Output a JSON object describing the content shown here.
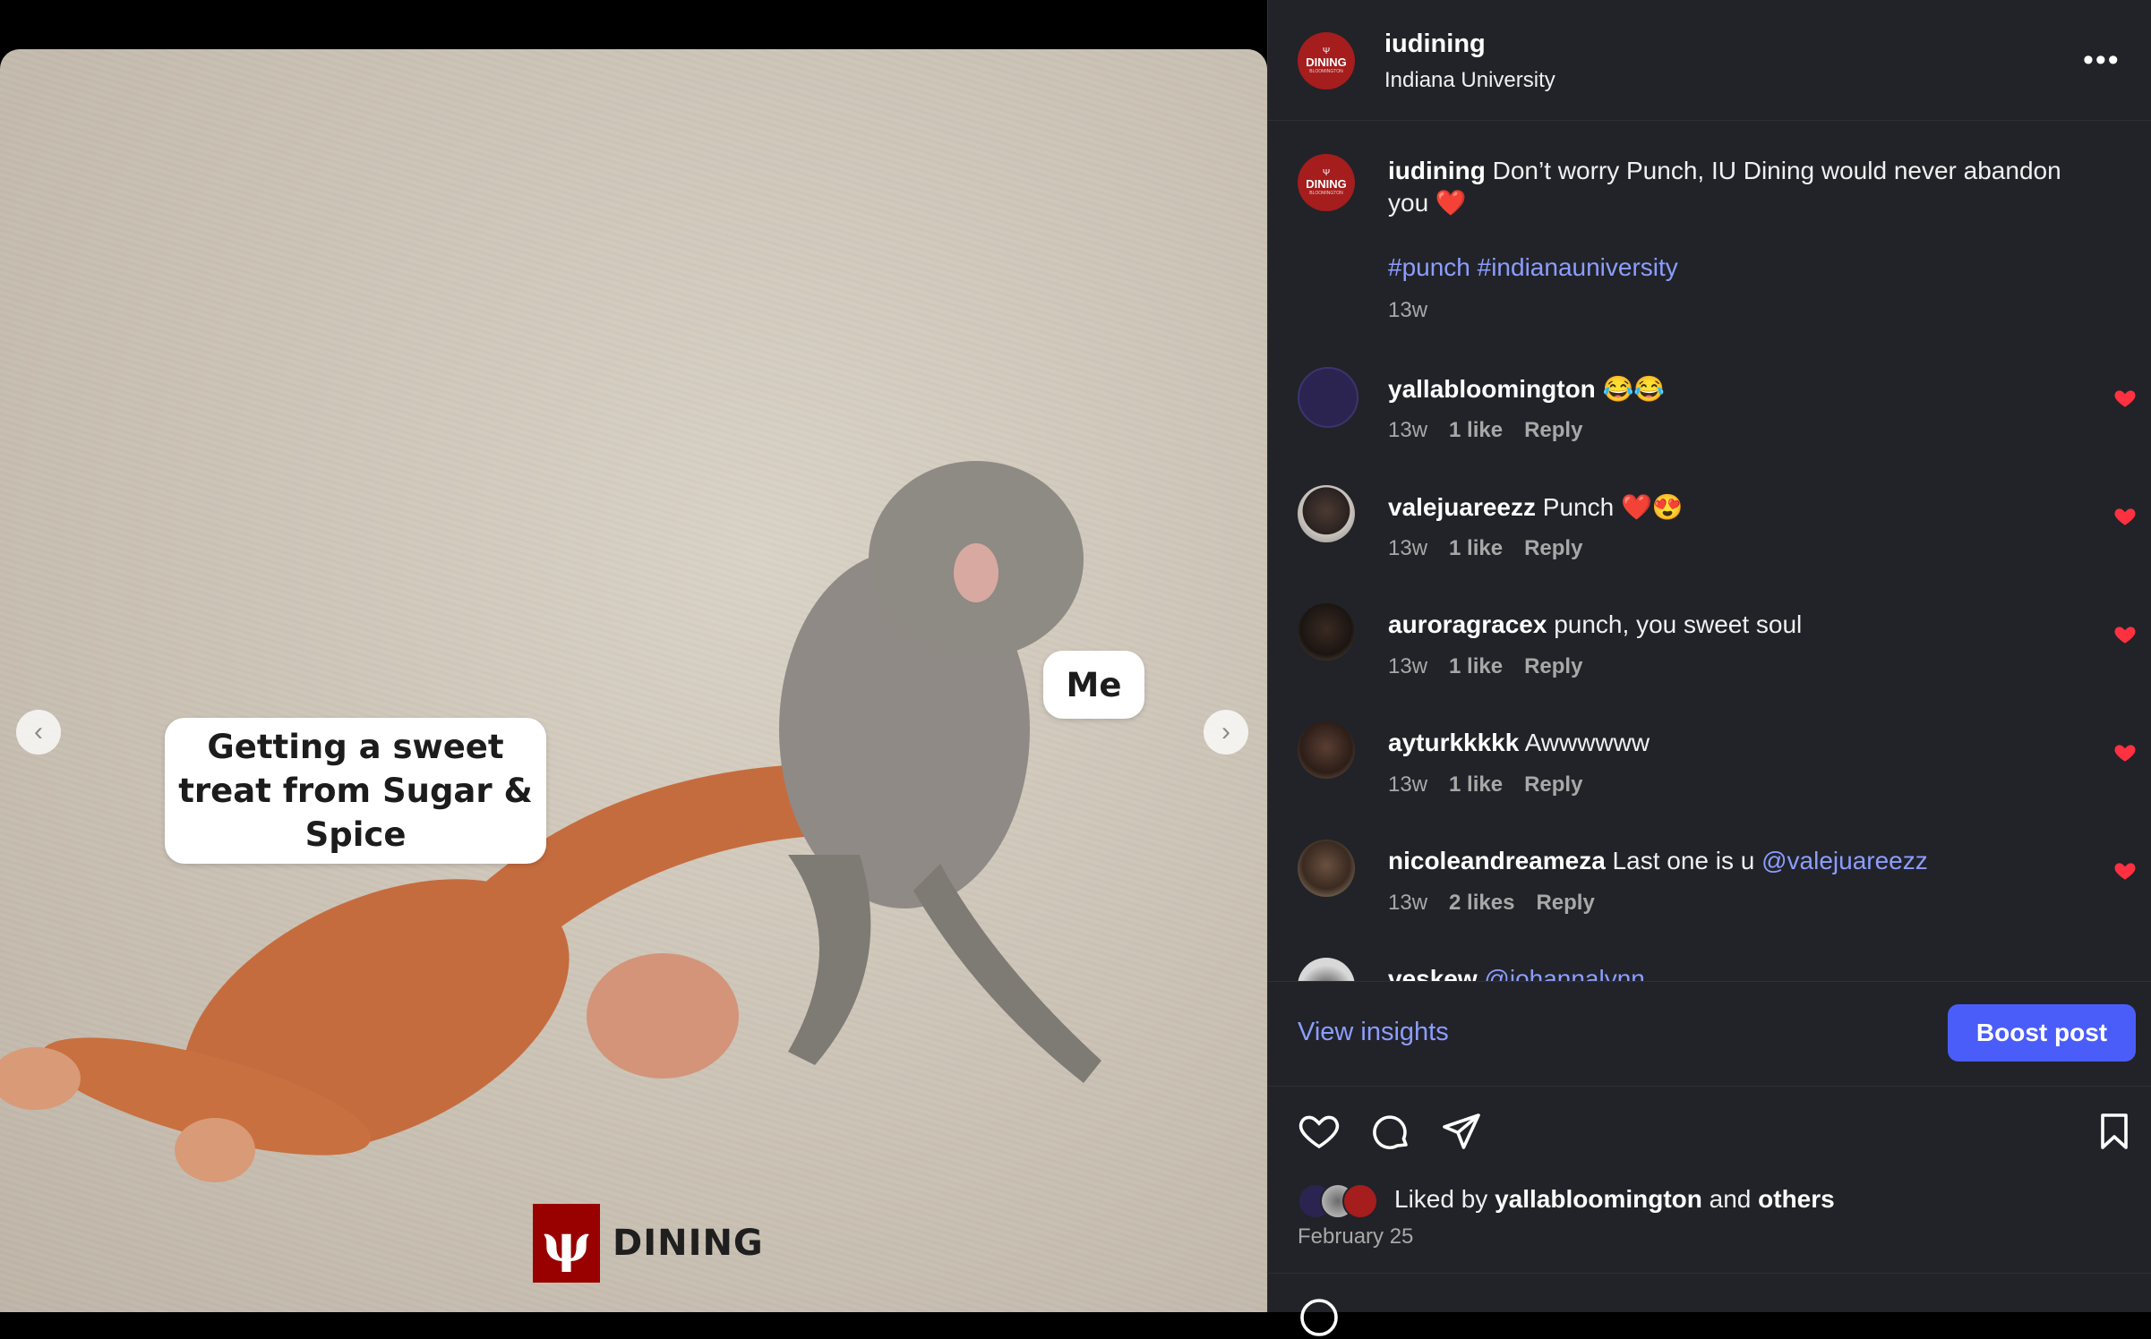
{
  "post": {
    "caption_left": "Getting a sweet treat from Sugar & Spice",
    "caption_right": "Me",
    "logo_text": "DINING",
    "logo_mark": "ψ",
    "prev_arrow": "‹",
    "next_arrow": "›"
  },
  "header": {
    "username": "iudining",
    "location": "Indiana University",
    "more": "•••",
    "avatar": {
      "line1": "Ψ",
      "line2": "DINING",
      "line3": "BLOOMINGTON"
    }
  },
  "caption": {
    "username": "iudining",
    "text": " Don’t worry Punch, IU Dining would never abandon you ❤️",
    "hashtags": "#punch #indianauniversity",
    "time": "13w"
  },
  "comments": [
    {
      "username": "yallabloomington",
      "text": " 😂😂",
      "time": "13w",
      "likes": "1 like",
      "reply": "Reply"
    },
    {
      "username": "valejuareezz",
      "text": " Punch ❤️😍",
      "time": "13w",
      "likes": "1 like",
      "reply": "Reply"
    },
    {
      "username": "auroragracex",
      "text": " punch, you sweet soul",
      "time": "13w",
      "likes": "1 like",
      "reply": "Reply"
    },
    {
      "username": "ayturkkkkk",
      "text": " Awwwwww",
      "time": "13w",
      "likes": "1 like",
      "reply": "Reply"
    },
    {
      "username": "nicoleandreameza",
      "text": " Last one is u ",
      "mention": "@valejuareezz",
      "time": "13w",
      "likes": "2 likes",
      "reply": "Reply"
    },
    {
      "username": "veskew",
      "text": " ",
      "mention": "@johannalynn"
    }
  ],
  "actions": {
    "view_insights": "View insights",
    "boost": "Boost post"
  },
  "likes": {
    "prefix": "Liked by ",
    "user": "yallabloomington",
    "middle": " and ",
    "others": "others",
    "date": "February 25"
  },
  "colors": {
    "accent": "#4a5df9",
    "link": "#8c9dff",
    "heart": "#ff3040",
    "iu_red": "#990000"
  }
}
